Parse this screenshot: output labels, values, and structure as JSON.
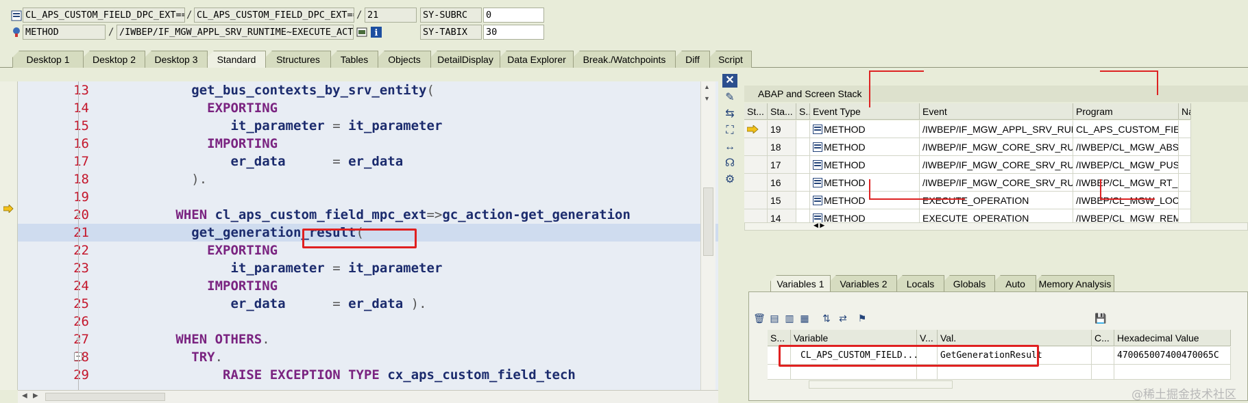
{
  "header": {
    "row1": {
      "program": "CL_APS_CUSTOM_FIELD_DPC_EXT==...",
      "include": "CL_APS_CUSTOM_FIELD_DPC_EXT==...",
      "line": "21",
      "sysvar_name": "SY-SUBRC",
      "sysvar_value": "0"
    },
    "row2": {
      "type": "METHOD",
      "event": "/IWBEP/IF_MGW_APPL_SRV_RUNTIME~EXECUTE_ACTI...",
      "sysvar_name": "SY-TABIX",
      "sysvar_value": "30"
    },
    "slash": "/"
  },
  "tabs": [
    "Desktop 1",
    "Desktop 2",
    "Desktop 3",
    "Standard",
    "Structures",
    "Tables",
    "Objects",
    "DetailDisplay",
    "Data Explorer",
    "Break./Watchpoints",
    "Diff",
    "Script"
  ],
  "active_tab": "Standard",
  "code": [
    {
      "n": "13",
      "text": "get_bus_contexts_by_srv_entity("
    },
    {
      "n": "14",
      "text": "EXPORTING"
    },
    {
      "n": "15",
      "text": "it_parameter = it_parameter"
    },
    {
      "n": "16",
      "text": "IMPORTING"
    },
    {
      "n": "17",
      "text": "er_data      = er_data"
    },
    {
      "n": "18",
      "text": ")."
    },
    {
      "n": "19",
      "text": ""
    },
    {
      "n": "20",
      "text": "WHEN cl_aps_custom_field_mpc_ext=>gc_action-get_generation"
    },
    {
      "n": "21",
      "text": "get_generation_result("
    },
    {
      "n": "22",
      "text": "EXPORTING"
    },
    {
      "n": "23",
      "text": "it_parameter = it_parameter"
    },
    {
      "n": "24",
      "text": "IMPORTING"
    },
    {
      "n": "25",
      "text": "er_data      = er_data )."
    },
    {
      "n": "26",
      "text": ""
    },
    {
      "n": "27",
      "text": "WHEN OTHERS."
    },
    {
      "n": "28",
      "text": "TRY."
    },
    {
      "n": "29",
      "text": "RAISE EXCEPTION TYPE cx_aps_custom_field_tech"
    }
  ],
  "stack": {
    "title": "ABAP and Screen Stack",
    "headers": [
      "St...",
      "Sta...",
      "S...",
      "Event Type",
      "Event",
      "Program",
      "Na"
    ],
    "rows": [
      {
        "level": "19",
        "type": "METHOD",
        "event": "/IWBEP/IF_MGW_APPL_SRV_RUNTIM",
        "program": "CL_APS_CUSTOM_FIELD..."
      },
      {
        "level": "18",
        "type": "METHOD",
        "event": "/IWBEP/IF_MGW_CORE_SRV_RUNTI...",
        "program": "/IWBEP/CL_MGW_ABS_..."
      },
      {
        "level": "17",
        "type": "METHOD",
        "event": "/IWBEP/IF_MGW_CORE_SRV_RUNTI...",
        "program": "/IWBEP/CL_MGW_PUSH..."
      },
      {
        "level": "16",
        "type": "METHOD",
        "event": "/IWBEP/IF_MGW_CORE_SRV_RUNTI...",
        "program": "/IWBEP/CL_MGW_RT_D..."
      },
      {
        "level": "15",
        "type": "METHOD",
        "event": "EXECUTE_OPERATION",
        "program": "/IWBEP/CL_MGW_LOCA..."
      },
      {
        "level": "14",
        "type": "METHOD",
        "event": "EXECUTE_OPERATION",
        "program": "/IWBEP/CL_MGW_REMO..."
      }
    ]
  },
  "var_tabs": [
    "Variables 1",
    "Variables 2",
    "Locals",
    "Globals",
    "Auto",
    "Memory Analysis"
  ],
  "variables": {
    "headers": [
      "S...",
      "Variable",
      "V...",
      "Val.",
      "C...",
      "Hexadecimal Value"
    ],
    "rows": [
      {
        "variable": "CL_APS_CUSTOM_FIELD...",
        "value": "GetGenerationResult",
        "hex": "470065007400470065C"
      }
    ]
  },
  "watermark": "@稀土掘金技术社区"
}
